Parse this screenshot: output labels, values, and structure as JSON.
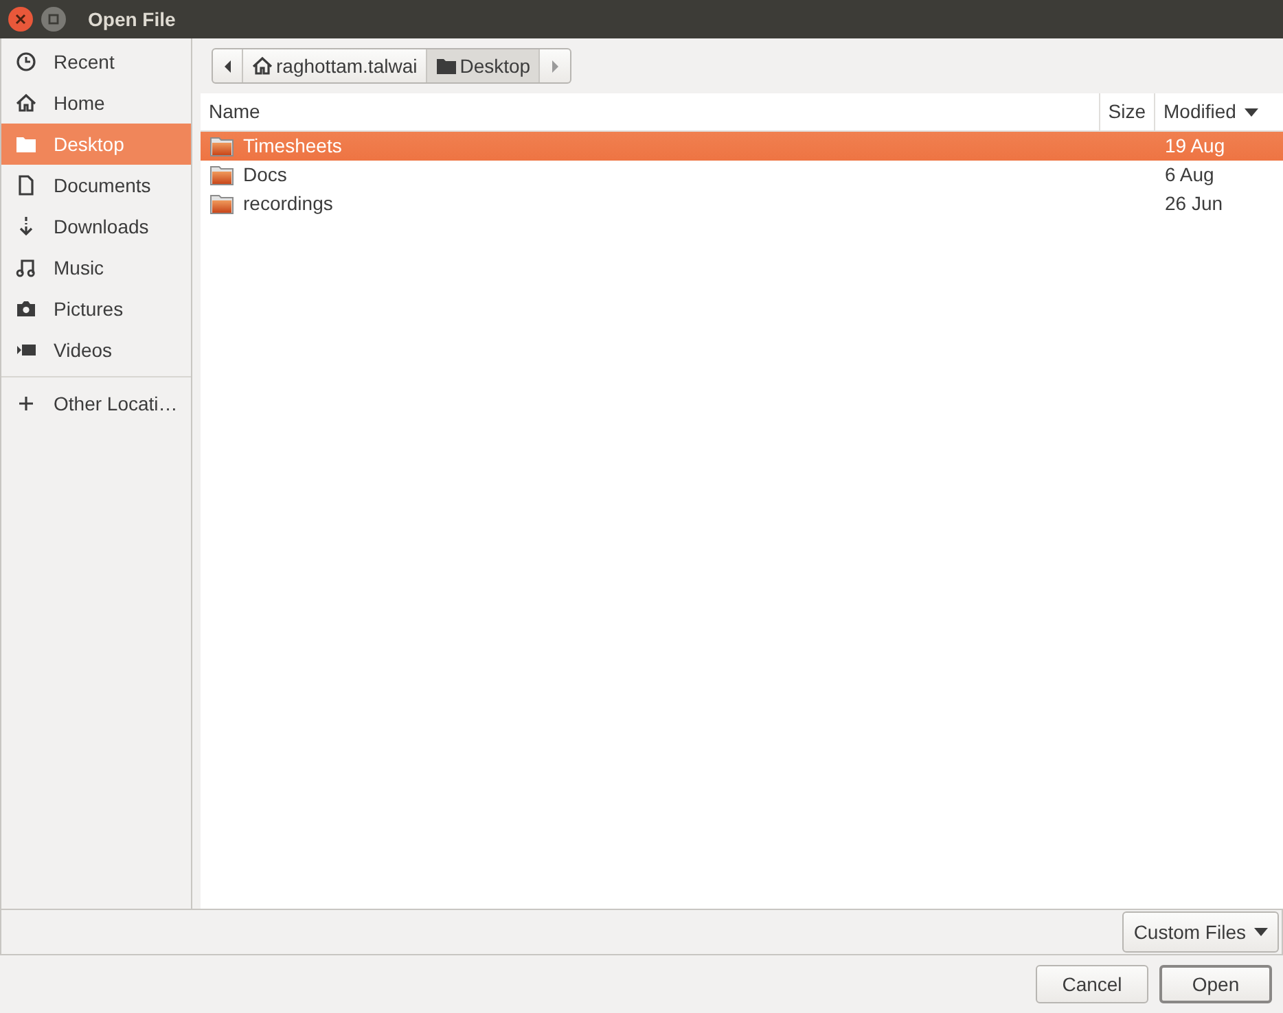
{
  "window": {
    "title": "Open File"
  },
  "sidebar": {
    "items": [
      {
        "label": "Recent",
        "kind": "recent",
        "selected": false
      },
      {
        "label": "Home",
        "kind": "home",
        "selected": false
      },
      {
        "label": "Desktop",
        "kind": "folder",
        "selected": true
      },
      {
        "label": "Documents",
        "kind": "document",
        "selected": false
      },
      {
        "label": "Downloads",
        "kind": "download",
        "selected": false
      },
      {
        "label": "Music",
        "kind": "music",
        "selected": false
      },
      {
        "label": "Pictures",
        "kind": "camera",
        "selected": false
      },
      {
        "label": "Videos",
        "kind": "video",
        "selected": false
      }
    ],
    "other": {
      "label": "Other Locati…"
    }
  },
  "path_bar": {
    "items": [
      {
        "label": "raghottam.talwai",
        "kind": "home",
        "selected": false
      },
      {
        "label": "Desktop",
        "kind": "folder",
        "selected": true
      }
    ]
  },
  "table": {
    "columns": [
      {
        "label": "Name",
        "sorted": false
      },
      {
        "label": "Size",
        "sorted": false
      },
      {
        "label": "Modified",
        "sorted": true
      }
    ],
    "rows": [
      {
        "name": "Timesheets",
        "modified": "19 Aug",
        "selected": true
      },
      {
        "name": "Docs",
        "modified": "6 Aug",
        "selected": false
      },
      {
        "name": "recordings",
        "modified": "26 Jun",
        "selected": false
      }
    ]
  },
  "filter": {
    "label": "Custom Files"
  },
  "buttons": [
    {
      "label": "Cancel",
      "kind": "plain"
    },
    {
      "label": "Open",
      "kind": "default"
    }
  ]
}
